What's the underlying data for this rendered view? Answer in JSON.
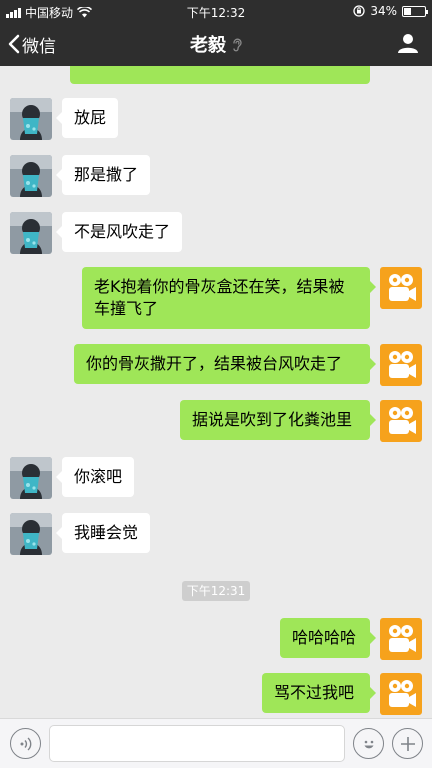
{
  "status_bar": {
    "carrier": "中国移动",
    "time": "下午12:32",
    "battery_percent": 34,
    "battery_text": "34%"
  },
  "nav": {
    "back_label": "微信",
    "title": "老毅"
  },
  "messages": [
    {
      "side": "out",
      "text": ""
    },
    {
      "side": "in",
      "text": "放屁"
    },
    {
      "side": "in",
      "text": "那是撒了"
    },
    {
      "side": "in",
      "text": "不是风吹走了"
    },
    {
      "side": "out",
      "text": "老K抱着你的骨灰盒还在笑，结果被车撞飞了"
    },
    {
      "side": "out",
      "text": "你的骨灰撒开了，结果被台风吹走了"
    },
    {
      "side": "out",
      "text": "据说是吹到了化粪池里"
    },
    {
      "side": "in",
      "text": "你滚吧"
    },
    {
      "side": "in",
      "text": "我睡会觉"
    },
    {
      "side": "out",
      "text": "哈哈哈哈"
    },
    {
      "side": "out",
      "text": "骂不过我吧"
    }
  ],
  "timestamp": "下午12:31",
  "input": {
    "value": ""
  },
  "colors": {
    "nav_bg": "#2e2e2e",
    "chat_bg": "#ebebeb",
    "out_bubble": "#9fe658",
    "in_bubble": "#ffffff",
    "own_avatar_bg": "#f6a21c"
  }
}
